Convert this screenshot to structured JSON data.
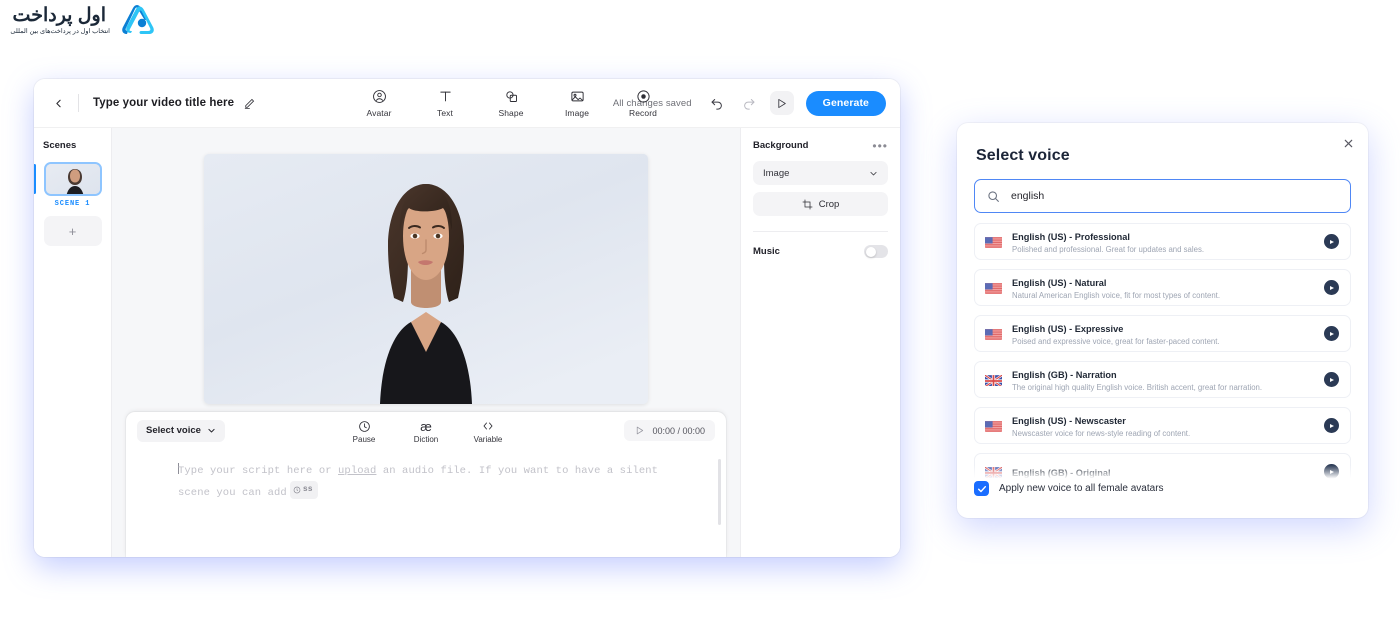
{
  "logo": {
    "name_fa": "اول پرداخت",
    "tagline_fa": "انتخاب اول در پرداخت‌های بین المللی",
    "mark_color": "#29b6f6"
  },
  "app": {
    "topbar": {
      "back_icon": "chevron-left-icon",
      "title_placeholder": "Type your video title here",
      "edit_icon": "pencil-icon",
      "tools": [
        {
          "label": "Avatar",
          "icon": "avatar-icon"
        },
        {
          "label": "Text",
          "icon": "text-icon"
        },
        {
          "label": "Shape",
          "icon": "shape-icon"
        },
        {
          "label": "Image",
          "icon": "image-icon"
        },
        {
          "label": "Record",
          "icon": "record-icon"
        }
      ],
      "save_status": "All changes saved",
      "undo_icon": "undo-icon",
      "redo_icon": "redo-icon",
      "preview_icon": "play-icon",
      "generate_label": "Generate",
      "accent_color": "#1a8cff"
    },
    "scenes": {
      "heading": "Scenes",
      "items": [
        {
          "label": "SCENE 1",
          "active": true
        }
      ],
      "add_label": "+"
    },
    "script": {
      "select_voice_label": "Select voice",
      "tools": [
        {
          "label": "Pause",
          "icon": "clock-icon"
        },
        {
          "label": "Diction",
          "icon": "phonetic-ae-icon"
        },
        {
          "label": "Variable",
          "icon": "code-brackets-icon"
        }
      ],
      "time_display": "00:00 / 00:00",
      "placeholder_part1": "Type your script here or ",
      "placeholder_link": "upload",
      "placeholder_part2": " an audio file. If you want to have a silent scene you can add",
      "silent_chip": "ss"
    },
    "right_panel": {
      "background_title": "Background",
      "more_icon": "ellipsis-icon",
      "background_value": "Image",
      "crop_label": "Crop",
      "music_title": "Music",
      "music_enabled": false
    }
  },
  "dialog": {
    "title": "Select voice",
    "close_icon": "close-icon",
    "search": {
      "value": "english",
      "icon": "search-icon"
    },
    "voices": [
      {
        "name": "English (US) - Professional",
        "desc": "Polished and professional. Great for updates and sales.",
        "flag": "us"
      },
      {
        "name": "English (US) - Natural",
        "desc": "Natural American English voice, fit for most types of content.",
        "flag": "us"
      },
      {
        "name": "English (US) - Expressive",
        "desc": "Poised and expressive voice, great for faster-paced content.",
        "flag": "us"
      },
      {
        "name": "English (GB) - Narration",
        "desc": "The original high quality English voice. British accent, great for narration.",
        "flag": "gb"
      },
      {
        "name": "English (US) - Newscaster",
        "desc": "Newscaster voice for news-style reading of content.",
        "flag": "us"
      },
      {
        "name": "English (GB) - Original",
        "desc": "",
        "flag": "gb"
      }
    ],
    "footer": {
      "checkbox_label": "Apply new voice to all female avatars",
      "checked": true,
      "checkbox_color": "#1a6dff"
    }
  }
}
